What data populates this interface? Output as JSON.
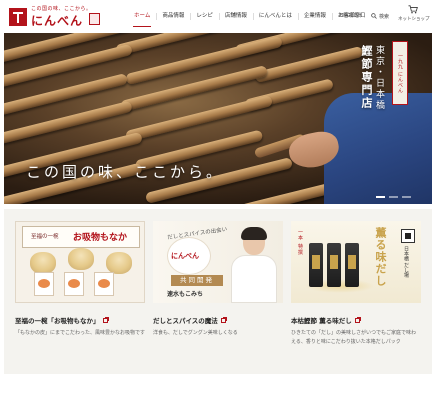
{
  "header": {
    "logo": {
      "tagline": "この国の味、ここから。",
      "name": "にんべん"
    },
    "nav": [
      {
        "label": "ホーム",
        "active": true
      },
      {
        "label": "商品情報",
        "active": false
      },
      {
        "label": "レシピ",
        "active": false
      },
      {
        "label": "店舗情報",
        "active": false
      },
      {
        "label": "にんべんとは",
        "active": false
      },
      {
        "label": "企業情報",
        "active": false
      },
      {
        "label": "お客様窓口",
        "active": false
      }
    ],
    "language": "ENGLISH",
    "search_label": "検索",
    "shop_label": "ネットショップ"
  },
  "hero": {
    "catchphrase": "この国の味、ここから。",
    "vertical_text_1": "東京・日本橋",
    "vertical_text_2": "鰹節専門店",
    "badge_text": "一九九 にんべん",
    "slide_count": 3,
    "active_slide": 1
  },
  "cards": [
    {
      "image_subtitle": "至福の一椀",
      "image_title": "お吸物もなか",
      "title": "至福の一椀「お吸物もなか」",
      "description": "「もなかの皮」にまでこだわった、風味豊かなお吸物です"
    },
    {
      "image_kicker": "だしとスパイスの出会い",
      "image_logo": "にんべん",
      "image_band": "共同開発",
      "image_name": "速水もこみち",
      "title": "だしとスパイスの魔法",
      "description": "洋食も、だしでグングン美味しくなる"
    },
    {
      "image_vertical_a": "一本 特撰",
      "image_title": "薫る味だし",
      "image_vertical_b": "日本橋 だし場",
      "title": "本枯鰹節 薫る味だし",
      "description": "ひきたての「だし」の美味しさがいつでもご家庭で味わえる、香りと味にこだわり抜いた本格だしパック"
    }
  ],
  "colors": {
    "brand_red": "#b3131b",
    "card_section_bg": "#f4f3ef",
    "gold": "#c9a34c"
  }
}
